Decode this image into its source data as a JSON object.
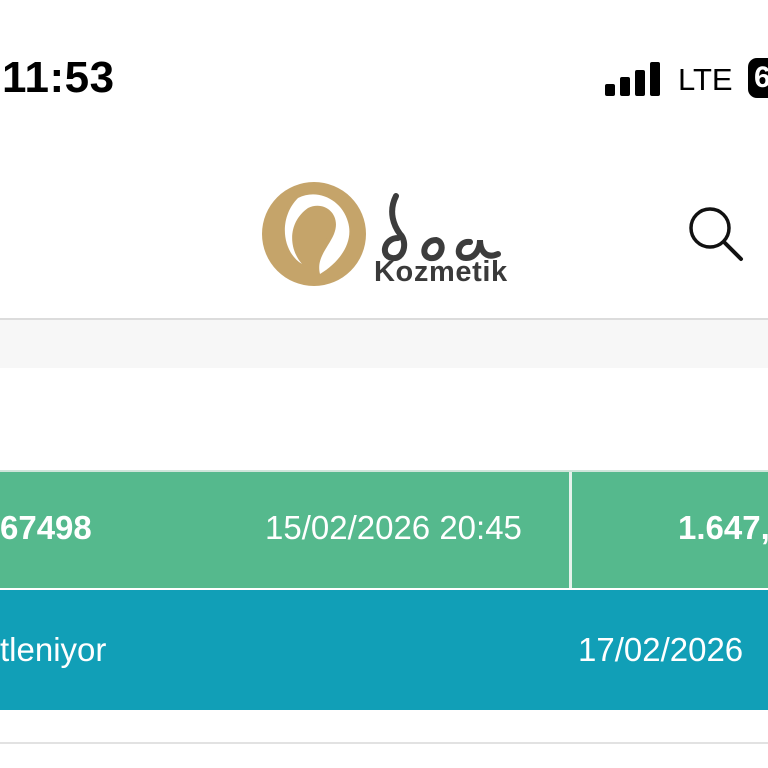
{
  "status_bar": {
    "time": "11:53",
    "network": "LTE",
    "battery": "6",
    "signal_bars": 4
  },
  "header": {
    "brand_name": "Kozmetik",
    "logo_script": "doa",
    "icons": [
      "logo-emblem",
      "search-icon"
    ]
  },
  "order": {
    "number": "67498",
    "created_at": "15/02/2026 20:45",
    "amount": "1.647,",
    "status": "tleniyor",
    "status_date": "17/02/2026"
  },
  "colors": {
    "order_row": "#55b98d",
    "status_row": "#119fb7",
    "logo_gold": "#c5a46a"
  }
}
